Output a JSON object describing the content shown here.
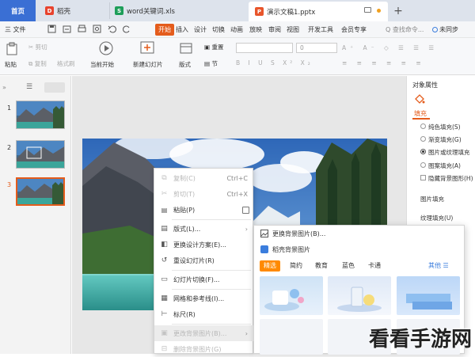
{
  "tabs": [
    {
      "label": "首页"
    },
    {
      "label": "稻壳"
    },
    {
      "label": "word关键词.xls"
    },
    {
      "label": "演示文稿1.pptx"
    }
  ],
  "new_tab": "+",
  "menu": {
    "items": [
      "三 文件",
      "开始",
      "插入",
      "设计",
      "切换",
      "动画",
      "放映",
      "审阅",
      "视图",
      "开发工具",
      "会员专享"
    ],
    "search_placeholder": "Q 查找命令...",
    "sync": "未同步"
  },
  "ribbon": {
    "paste": "粘贴",
    "cut": "剪切",
    "copy": "复制",
    "format_painter": "格式刷",
    "play_from_current": "当前开始",
    "new_slide": "新建幻灯片",
    "layout": "版式",
    "reset": "重置",
    "section": "节",
    "font_size": "0"
  },
  "slides": [
    {
      "no": "1"
    },
    {
      "no": "2"
    },
    {
      "no": "3"
    }
  ],
  "right_pane": {
    "title": "对象属性",
    "tab": "填充",
    "options": [
      "纯色填充(S)",
      "渐变填充(G)",
      "图片或纹理填充",
      "图案填充(A)",
      "隐藏背景图形(H)"
    ],
    "picture_fill": "图片填充",
    "texture_fill": "纹理填充(U)"
  },
  "context_menu": [
    {
      "icon": "copy-icon",
      "glyph": "⧉",
      "label": "复制(C)",
      "key": "Ctrl+C",
      "disabled": true
    },
    {
      "icon": "cut-icon",
      "glyph": "✂",
      "label": "剪切(T)",
      "key": "Ctrl+X",
      "disabled": true
    },
    {
      "icon": "paste-icon",
      "glyph": "📋",
      "label": "粘贴(P)",
      "key": "",
      "disabled": false
    },
    {
      "icon": "layout-icon",
      "glyph": "▤",
      "label": "版式(L)...",
      "key": "",
      "disabled": false
    },
    {
      "icon": "design-icon",
      "glyph": "◧",
      "label": "更换设计方案(E)...",
      "key": "",
      "disabled": false
    },
    {
      "icon": "reset-icon",
      "glyph": "↺",
      "label": "重设幻灯片(R)",
      "key": "",
      "disabled": false
    },
    {
      "icon": "transition-icon",
      "glyph": "▭",
      "label": "幻灯片切换(F)...",
      "key": "",
      "disabled": false
    },
    {
      "icon": "grid-icon",
      "glyph": "▦",
      "label": "网格和参考线(I)...",
      "key": "",
      "disabled": false
    },
    {
      "icon": "ruler-icon",
      "glyph": "⊢",
      "label": "标尺(R)",
      "key": "",
      "disabled": false
    },
    {
      "icon": "change-bg-icon",
      "glyph": "▣",
      "label": "更改背景图片(B)...",
      "key": "",
      "disabled": true
    },
    {
      "icon": "delete-bg-icon",
      "glyph": "⊟",
      "label": "删除背景图片(G)",
      "key": "",
      "disabled": true
    }
  ],
  "submenu": {
    "replace_bg": "更换背景图片(B)...",
    "docer_bg": "稻壳背景图片",
    "chips": [
      "精选",
      "简约",
      "教育",
      "蓝色",
      "卡通"
    ],
    "more": "其他 ☰"
  },
  "watermark": "看看手游网",
  "colors": {
    "accent": "#e45c1c",
    "tab_bar": "#dde3ec",
    "chip_active": "#ff8a00",
    "link": "#3b7ddd"
  }
}
